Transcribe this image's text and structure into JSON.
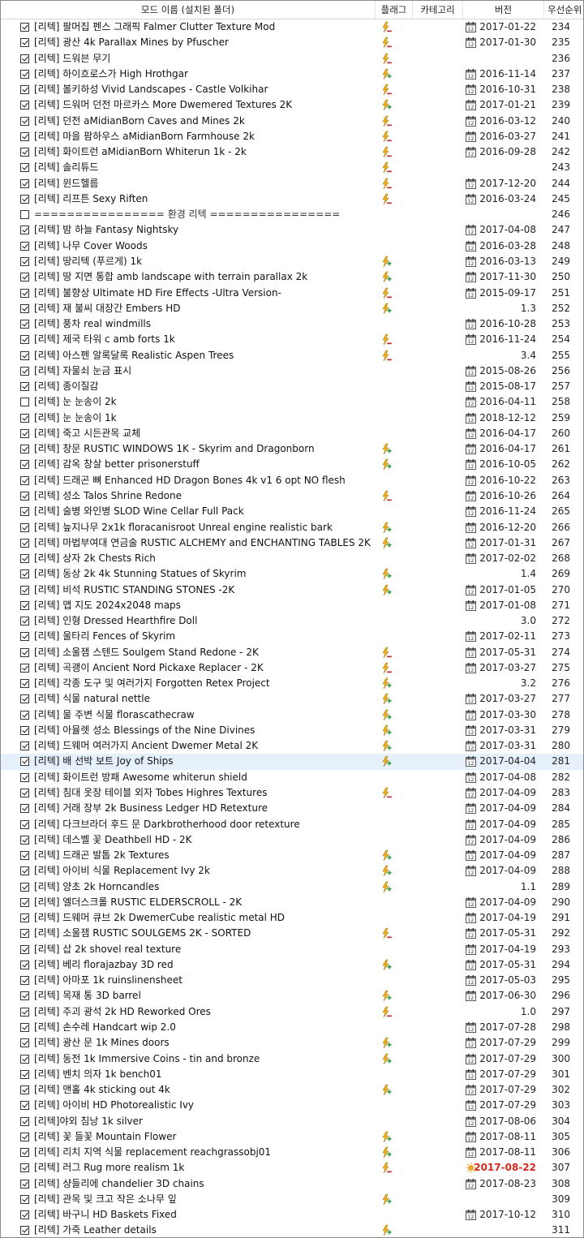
{
  "header": {
    "name": "모드 이름 (설치된 폴더)",
    "flags": "플래그",
    "category": "카테고리",
    "version": "버전",
    "priority": "우선순위"
  },
  "colors": {
    "selected_row": "#e6f0fb",
    "version_highlight": "#d12a1f"
  },
  "rows": [
    {
      "checked": true,
      "name": "[리텍] 팔머집 펜스 그래픽 Falmer Clutter Texture Mod",
      "flag": "flag-minus",
      "vicon": "calendar",
      "version": "2017-01-22",
      "priority": "234"
    },
    {
      "checked": true,
      "name": "[리텍] 광산 4k Parallax Mines by Pfuscher",
      "flag": "flag-minus",
      "vicon": "calendar",
      "version": "2017-01-30",
      "priority": "235"
    },
    {
      "checked": true,
      "name": "[리텍] 드워븐 무기",
      "flag": "flag-minus",
      "vicon": "",
      "version": "",
      "priority": "236"
    },
    {
      "checked": true,
      "name": "[리텍] 하이흐로스가 High Hrothgar",
      "flag": "flag-plus",
      "vicon": "calendar",
      "version": "2016-11-14",
      "priority": "237"
    },
    {
      "checked": true,
      "name": "[리텍] 볼키하성 Vivid Landscapes - Castle Volkihar",
      "flag": "flag-minus",
      "vicon": "calendar",
      "version": "2016-10-31",
      "priority": "238"
    },
    {
      "checked": true,
      "name": "[리텍] 드워머 던전 마르카스 More Dwemered Textures 2K",
      "flag": "flag-plus",
      "vicon": "calendar",
      "version": "2017-01-21",
      "priority": "239"
    },
    {
      "checked": true,
      "name": "[리텍] 던전 aMidianBorn Caves and Mines 2k",
      "flag": "flag-minus",
      "vicon": "calendar",
      "version": "2016-03-12",
      "priority": "240"
    },
    {
      "checked": true,
      "name": "[리텍] 마을 팜하우스 aMidianBorn Farmhouse 2k",
      "flag": "flag-minus",
      "vicon": "calendar",
      "version": "2016-03-27",
      "priority": "241"
    },
    {
      "checked": true,
      "name": "[리텍] 화이트런 aMidianBorn Whiterun 1k - 2k",
      "flag": "flag-minus",
      "vicon": "calendar",
      "version": "2016-09-28",
      "priority": "242"
    },
    {
      "checked": true,
      "name": "[리텍] 솔리튜드",
      "flag": "flag-minus",
      "vicon": "",
      "version": "",
      "priority": "243"
    },
    {
      "checked": true,
      "name": "[리텍] 윈드헬름",
      "flag": "flag-minus",
      "vicon": "calendar",
      "version": "2017-12-20",
      "priority": "244"
    },
    {
      "checked": true,
      "name": "[리텍] 리프튼 Sexy Riften",
      "flag": "flag-minus",
      "vicon": "calendar",
      "version": "2016-03-24",
      "priority": "245"
    },
    {
      "checked": false,
      "name": "================ 환경 리텍 ================",
      "flag": "",
      "vicon": "",
      "version": "",
      "priority": "246",
      "sep": true
    },
    {
      "checked": true,
      "name": "[리텍] 밤 하늘 Fantasy Nightsky",
      "flag": "",
      "vicon": "calendar",
      "version": "2017-04-08",
      "priority": "247"
    },
    {
      "checked": true,
      "name": "[리텍] 나무 Cover Woods",
      "flag": "",
      "vicon": "calendar",
      "version": "2016-03-28",
      "priority": "248"
    },
    {
      "checked": true,
      "name": "[리텍] 땅리텍 (푸르게) 1k",
      "flag": "flag-plus",
      "vicon": "calendar",
      "version": "2016-03-13",
      "priority": "249"
    },
    {
      "checked": true,
      "name": "[리텍] 땅 지면 통합 amb landscape with terrain parallax 2k",
      "flag": "flag-plus",
      "vicon": "calendar",
      "version": "2017-11-30",
      "priority": "250"
    },
    {
      "checked": true,
      "name": "[리텍] 불향상 Ultimate HD Fire Effects -Ultra Version-",
      "flag": "flag-minus",
      "vicon": "calendar",
      "version": "2015-09-17",
      "priority": "251"
    },
    {
      "checked": true,
      "name": "[리텍] 재 불씨 대장간 Embers HD",
      "flag": "flag-plus",
      "vicon": "",
      "version": "1.3",
      "priority": "252"
    },
    {
      "checked": true,
      "name": "[리텍] 풍차 real windmills",
      "flag": "",
      "vicon": "calendar",
      "version": "2016-10-28",
      "priority": "253"
    },
    {
      "checked": true,
      "name": "[리텍] 제국 타워 c amb forts 1k",
      "flag": "flag-minus",
      "vicon": "calendar",
      "version": "2016-11-24",
      "priority": "254"
    },
    {
      "checked": true,
      "name": "[리텍] 아스펜 알록달록 Realistic Aspen Trees",
      "flag": "flag-minus",
      "vicon": "",
      "version": "3.4",
      "priority": "255"
    },
    {
      "checked": true,
      "name": "[리텍] 자물쇠 눈금 표시",
      "flag": "",
      "vicon": "calendar",
      "version": "2015-08-26",
      "priority": "256"
    },
    {
      "checked": true,
      "name": "[리텍] 종이질감",
      "flag": "",
      "vicon": "calendar",
      "version": "2015-08-17",
      "priority": "257"
    },
    {
      "checked": false,
      "name": "[리텍] 눈 눈송이 2k",
      "flag": "",
      "vicon": "calendar",
      "version": "2016-04-11",
      "priority": "258"
    },
    {
      "checked": true,
      "name": "[리텍] 눈 눈송이 1k",
      "flag": "",
      "vicon": "calendar",
      "version": "2018-12-12",
      "priority": "259"
    },
    {
      "checked": true,
      "name": "[리텍] 죽고 시든관목 교체",
      "flag": "",
      "vicon": "calendar",
      "version": "2016-04-17",
      "priority": "260"
    },
    {
      "checked": true,
      "name": "[리텍] 창문 RUSTIC WINDOWS 1K - Skyrim and Dragonborn",
      "flag": "flag-plus",
      "vicon": "calendar",
      "version": "2016-04-17",
      "priority": "261"
    },
    {
      "checked": true,
      "name": "[리텍] 감옥 창살 better prisonerstuff",
      "flag": "flag-plus",
      "vicon": "calendar",
      "version": "2016-10-05",
      "priority": "262"
    },
    {
      "checked": true,
      "name": "[리텍] 드래곤 뼈 Enhanced HD Dragon Bones 4k v1 6 opt NO flesh",
      "flag": "",
      "vicon": "calendar",
      "version": "2016-10-22",
      "priority": "263"
    },
    {
      "checked": true,
      "name": "[리텍] 성소 Talos Shrine Redone",
      "flag": "flag-minus",
      "vicon": "calendar",
      "version": "2016-10-26",
      "priority": "264"
    },
    {
      "checked": true,
      "name": "[리텍] 술병 와인병 SLOD Wine Cellar Full Pack",
      "flag": "",
      "vicon": "calendar",
      "version": "2016-11-24",
      "priority": "265"
    },
    {
      "checked": true,
      "name": "[리텍] 늪지나무 2x1k floracanisroot Unreal engine realistic bark",
      "flag": "flag-plus",
      "vicon": "calendar",
      "version": "2016-12-20",
      "priority": "266"
    },
    {
      "checked": true,
      "name": "[리텍] 마법부여대 연금술 RUSTIC ALCHEMY and ENCHANTING TABLES 2K",
      "flag": "flag-plus",
      "vicon": "calendar",
      "version": "2017-01-31",
      "priority": "267"
    },
    {
      "checked": true,
      "name": "[리텍] 상자 2k Chests Rich",
      "flag": "",
      "vicon": "calendar",
      "version": "2017-02-02",
      "priority": "268"
    },
    {
      "checked": true,
      "name": "[리텍] 동상 2k 4k Stunning Statues of Skyrim",
      "flag": "flag-plus",
      "vicon": "",
      "version": "1.4",
      "priority": "269"
    },
    {
      "checked": true,
      "name": "[리텍] 비석 RUSTIC STANDING STONES -2K",
      "flag": "flag-plus",
      "vicon": "calendar",
      "version": "2017-01-05",
      "priority": "270"
    },
    {
      "checked": true,
      "name": "[리텍] 맵 지도 2024x2048 maps",
      "flag": "",
      "vicon": "calendar",
      "version": "2017-01-08",
      "priority": "271"
    },
    {
      "checked": true,
      "name": "[리텍] 인형 Dressed Hearthfire Doll",
      "flag": "",
      "vicon": "",
      "version": "3.0",
      "priority": "272"
    },
    {
      "checked": true,
      "name": "[리텍] 울타리 Fences of Skyrim",
      "flag": "",
      "vicon": "calendar",
      "version": "2017-02-11",
      "priority": "273"
    },
    {
      "checked": true,
      "name": "[리텍] 소울잼 스텐드 Soulgem Stand Redone - 2K",
      "flag": "flag-minus",
      "vicon": "calendar",
      "version": "2017-05-31",
      "priority": "274"
    },
    {
      "checked": true,
      "name": "[리텍] 곡괭이 Ancient Nord Pickaxe Replacer - 2K",
      "flag": "flag-minus",
      "vicon": "calendar",
      "version": "2017-03-27",
      "priority": "275"
    },
    {
      "checked": true,
      "name": "[리텍] 각종 도구 및 여러가지 Forgotten Retex Project",
      "flag": "flag-plus",
      "vicon": "",
      "version": "3.2",
      "priority": "276"
    },
    {
      "checked": true,
      "name": "[리텍] 식물 natural nettle",
      "flag": "flag-plus",
      "vicon": "calendar",
      "version": "2017-03-27",
      "priority": "277"
    },
    {
      "checked": true,
      "name": "[리텍] 물 주변 식물 florascathecraw",
      "flag": "flag-plus",
      "vicon": "calendar",
      "version": "2017-03-30",
      "priority": "278"
    },
    {
      "checked": true,
      "name": "[리텍] 아뮬렛 성소 Blessings of the Nine Divines",
      "flag": "flag-plus",
      "vicon": "calendar",
      "version": "2017-03-31",
      "priority": "279"
    },
    {
      "checked": true,
      "name": "[리텍] 드웨머 여러가지 Ancient Dwemer Metal 2K",
      "flag": "flag-plus",
      "vicon": "calendar",
      "version": "2017-03-31",
      "priority": "280"
    },
    {
      "checked": true,
      "name": "[리텍] 배 선박 보트 Joy of Ships",
      "flag": "flag-plus",
      "vicon": "calendar",
      "version": "2017-04-04",
      "priority": "281",
      "selected": true
    },
    {
      "checked": true,
      "name": "[리텍] 화이트런 방패 Awesome whiterun shield",
      "flag": "",
      "vicon": "calendar",
      "version": "2017-04-08",
      "priority": "282"
    },
    {
      "checked": true,
      "name": "[리텍] 침대 옷장 테이블 외자 Tobes Highres Textures",
      "flag": "flag-minus",
      "vicon": "calendar",
      "version": "2017-04-09",
      "priority": "283"
    },
    {
      "checked": true,
      "name": "[리텍] 거래 장부 2k Business Ledger HD Retexture",
      "flag": "",
      "vicon": "calendar",
      "version": "2017-04-09",
      "priority": "284"
    },
    {
      "checked": true,
      "name": "[리텍] 다크브라더 후드 문 Darkbrotherhood door retexture",
      "flag": "",
      "vicon": "calendar",
      "version": "2017-04-09",
      "priority": "285"
    },
    {
      "checked": true,
      "name": "[리텍] 데스벨 꽃 Deathbell HD - 2K",
      "flag": "",
      "vicon": "calendar",
      "version": "2017-04-09",
      "priority": "286"
    },
    {
      "checked": true,
      "name": "[리텍] 드래곤 발톱 2k Textures",
      "flag": "flag-plus",
      "vicon": "calendar",
      "version": "2017-04-09",
      "priority": "287"
    },
    {
      "checked": true,
      "name": "[리텍] 아이비 식물 Replacement Ivy 2k",
      "flag": "flag-plus",
      "vicon": "calendar",
      "version": "2017-04-09",
      "priority": "288"
    },
    {
      "checked": true,
      "name": "[리텍] 양초 2k Horncandles",
      "flag": "flag-plus",
      "vicon": "",
      "version": "1.1",
      "priority": "289"
    },
    {
      "checked": true,
      "name": "[리텍] 엘더스크롤 RUSTIC ELDERSCROLL - 2K",
      "flag": "",
      "vicon": "calendar",
      "version": "2017-04-09",
      "priority": "290"
    },
    {
      "checked": true,
      "name": "[리텍] 드웨머 큐브 2k DwemerCube realistic metal HD",
      "flag": "",
      "vicon": "calendar",
      "version": "2017-04-19",
      "priority": "291"
    },
    {
      "checked": true,
      "name": "[리텍] 소울잼 RUSTIC SOULGEMS 2K - SORTED",
      "flag": "flag-minus",
      "vicon": "calendar",
      "version": "2017-05-31",
      "priority": "292"
    },
    {
      "checked": true,
      "name": "[리텍] 삽 2k shovel real texture",
      "flag": "",
      "vicon": "calendar",
      "version": "2017-04-19",
      "priority": "293"
    },
    {
      "checked": true,
      "name": "[리텍] 베리 florajazbay 3D red",
      "flag": "flag-plus",
      "vicon": "calendar",
      "version": "2017-05-31",
      "priority": "294"
    },
    {
      "checked": true,
      "name": "[리텍] 아마포 1k ruinslinensheet",
      "flag": "",
      "vicon": "calendar",
      "version": "2017-05-03",
      "priority": "295"
    },
    {
      "checked": true,
      "name": "[리텍] 목재 통 3D barrel",
      "flag": "flag-plus",
      "vicon": "calendar",
      "version": "2017-06-30",
      "priority": "296"
    },
    {
      "checked": true,
      "name": "[리텍] 주괴 광석 2k HD Reworked Ores",
      "flag": "flag-minus",
      "vicon": "",
      "version": "1.0",
      "priority": "297"
    },
    {
      "checked": true,
      "name": "[리텍] 손수레 Handcart wip 2.0",
      "flag": "",
      "vicon": "calendar",
      "version": "2017-07-28",
      "priority": "298"
    },
    {
      "checked": true,
      "name": "[리텍] 광산 문 1k Mines doors",
      "flag": "flag-plus",
      "vicon": "calendar",
      "version": "2017-07-29",
      "priority": "299"
    },
    {
      "checked": true,
      "name": "[리텍] 동전 1k Immersive Coins - tin and bronze",
      "flag": "flag-plus",
      "vicon": "calendar",
      "version": "2017-07-29",
      "priority": "300"
    },
    {
      "checked": true,
      "name": "[리텍] 벤치 의자 1k bench01",
      "flag": "",
      "vicon": "calendar",
      "version": "2017-07-29",
      "priority": "301"
    },
    {
      "checked": true,
      "name": "[리텍] 맨홀 4k sticking out 4k",
      "flag": "flag-plus",
      "vicon": "calendar",
      "version": "2017-07-29",
      "priority": "302"
    },
    {
      "checked": true,
      "name": "[리텍] 아이비 HD Photorealistic Ivy",
      "flag": "",
      "vicon": "calendar",
      "version": "2017-07-29",
      "priority": "303"
    },
    {
      "checked": true,
      "name": "[리텍]야외 침낭 1k silver",
      "flag": "",
      "vicon": "calendar",
      "version": "2017-08-06",
      "priority": "304"
    },
    {
      "checked": true,
      "name": "[리텍] 꽃 들꽃 Mountain Flower",
      "flag": "flag-plus",
      "vicon": "calendar",
      "version": "2017-08-11",
      "priority": "305"
    },
    {
      "checked": true,
      "name": "[리텍] 리치 지역 식물 replacement reachgrassobj01",
      "flag": "flag-plus",
      "vicon": "calendar",
      "version": "2017-08-11",
      "priority": "306"
    },
    {
      "checked": true,
      "name": "[리텍] 러그 Rug more realism 1k",
      "flag": "flag-minus",
      "vicon": "sun",
      "version": "2017-08-22",
      "priority": "307",
      "highlight": true
    },
    {
      "checked": true,
      "name": "[리텍] 샹들리에 chandelier 3D chains",
      "flag": "",
      "vicon": "calendar",
      "version": "2017-08-23",
      "priority": "308"
    },
    {
      "checked": true,
      "name": "[리텍] 관목 및 크고 작은 소나무 잎",
      "flag": "flag-plus",
      "vicon": "",
      "version": "",
      "priority": "309"
    },
    {
      "checked": true,
      "name": "[리텍] 바구니 HD Baskets Fixed",
      "flag": "",
      "vicon": "calendar",
      "version": "2017-10-12",
      "priority": "310"
    },
    {
      "checked": true,
      "name": "[리텍] 가죽 Leather details",
      "flag": "flag-plus",
      "vicon": "",
      "version": "",
      "priority": "311"
    }
  ]
}
